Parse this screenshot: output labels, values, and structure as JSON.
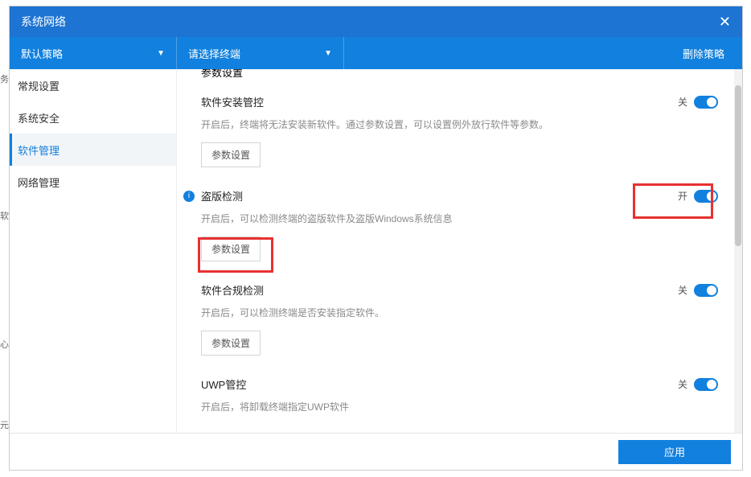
{
  "titlebar": {
    "title": "系统网络"
  },
  "toolbar": {
    "dropdown1": "默认策略",
    "dropdown2": "请选择终端",
    "delete": "删除策略"
  },
  "sidebar": {
    "items": [
      "常规设置",
      "系统安全",
      "软件管理",
      "网络管理"
    ],
    "active": 2
  },
  "param_label": "参数设置",
  "sections": [
    {
      "title": "软件安装管控",
      "desc": "开启后，终端将无法安装新软件。通过参数设置，可以设置例外放行软件等参数。",
      "state_label": "关",
      "state_on": false,
      "has_param": true,
      "info": false
    },
    {
      "title": "盗版检测",
      "desc": "开启后，可以检测终端的盗版软件及盗版Windows系统信息",
      "state_label": "开",
      "state_on": true,
      "has_param": true,
      "info": true
    },
    {
      "title": "软件合规检测",
      "desc": "开启后，可以检测终端是否安装指定软件。",
      "state_label": "关",
      "state_on": false,
      "has_param": true,
      "info": false
    },
    {
      "title": "UWP管控",
      "desc": "开启后，将卸载终端指定UWP软件",
      "state_label": "关",
      "state_on": false,
      "has_param": false,
      "info": false
    }
  ],
  "footer": {
    "apply": "应用"
  },
  "leftband": [
    "务",
    "软",
    "心",
    "元"
  ]
}
